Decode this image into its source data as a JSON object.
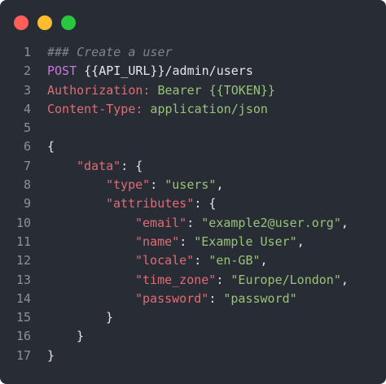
{
  "window": {
    "controls": {
      "close_color": "#ff5f57",
      "minimize_color": "#febc2e",
      "maximize_color": "#28c840"
    }
  },
  "colors": {
    "background": "#282c34",
    "comment": "#7f848e",
    "keyword": "#c678dd",
    "text": "#e6e6e6",
    "key": "#e06c75",
    "string": "#98c379",
    "punct": "#e6e6e6",
    "line_number": "#8c919a"
  },
  "code": {
    "lines": [
      {
        "number": "1",
        "indent": 0,
        "tokens": [
          {
            "text": "### Create a user",
            "type": "comment"
          }
        ]
      },
      {
        "number": "2",
        "indent": 0,
        "tokens": [
          {
            "text": "POST",
            "type": "keyword"
          },
          {
            "text": " {{API_URL}}/admin/users",
            "type": "text"
          }
        ]
      },
      {
        "number": "3",
        "indent": 0,
        "tokens": [
          {
            "text": "Authorization:",
            "type": "key"
          },
          {
            "text": " Bearer {{TOKEN}}",
            "type": "string"
          }
        ]
      },
      {
        "number": "4",
        "indent": 0,
        "tokens": [
          {
            "text": "Content-Type:",
            "type": "key"
          },
          {
            "text": " application/json",
            "type": "string"
          }
        ]
      },
      {
        "number": "5",
        "indent": 0,
        "tokens": []
      },
      {
        "number": "6",
        "indent": 0,
        "tokens": [
          {
            "text": "{",
            "type": "punct"
          }
        ]
      },
      {
        "number": "7",
        "indent": 1,
        "tokens": [
          {
            "text": "\"data\"",
            "type": "key"
          },
          {
            "text": ": {",
            "type": "punct"
          }
        ]
      },
      {
        "number": "8",
        "indent": 2,
        "tokens": [
          {
            "text": "\"type\"",
            "type": "key"
          },
          {
            "text": ": ",
            "type": "punct"
          },
          {
            "text": "\"users\"",
            "type": "string"
          },
          {
            "text": ",",
            "type": "punct"
          }
        ]
      },
      {
        "number": "9",
        "indent": 2,
        "tokens": [
          {
            "text": "\"attributes\"",
            "type": "key"
          },
          {
            "text": ": {",
            "type": "punct"
          }
        ]
      },
      {
        "number": "10",
        "indent": 3,
        "tokens": [
          {
            "text": "\"email\"",
            "type": "key"
          },
          {
            "text": ": ",
            "type": "punct"
          },
          {
            "text": "\"example2@user.org\"",
            "type": "string"
          },
          {
            "text": ",",
            "type": "punct"
          }
        ]
      },
      {
        "number": "11",
        "indent": 3,
        "tokens": [
          {
            "text": "\"name\"",
            "type": "key"
          },
          {
            "text": ": ",
            "type": "punct"
          },
          {
            "text": "\"Example User\"",
            "type": "string"
          },
          {
            "text": ",",
            "type": "punct"
          }
        ]
      },
      {
        "number": "12",
        "indent": 3,
        "tokens": [
          {
            "text": "\"locale\"",
            "type": "key"
          },
          {
            "text": ": ",
            "type": "punct"
          },
          {
            "text": "\"en-GB\"",
            "type": "string"
          },
          {
            "text": ",",
            "type": "punct"
          }
        ]
      },
      {
        "number": "13",
        "indent": 3,
        "tokens": [
          {
            "text": "\"time_zone\"",
            "type": "key"
          },
          {
            "text": ": ",
            "type": "punct"
          },
          {
            "text": "\"Europe/London\"",
            "type": "string"
          },
          {
            "text": ",",
            "type": "punct"
          }
        ]
      },
      {
        "number": "14",
        "indent": 3,
        "tokens": [
          {
            "text": "\"password\"",
            "type": "key"
          },
          {
            "text": ": ",
            "type": "punct"
          },
          {
            "text": "\"password\"",
            "type": "string"
          }
        ]
      },
      {
        "number": "15",
        "indent": 2,
        "tokens": [
          {
            "text": "}",
            "type": "punct"
          }
        ]
      },
      {
        "number": "16",
        "indent": 1,
        "tokens": [
          {
            "text": "}",
            "type": "punct"
          }
        ]
      },
      {
        "number": "17",
        "indent": 0,
        "tokens": [
          {
            "text": "}",
            "type": "punct"
          }
        ]
      }
    ]
  }
}
